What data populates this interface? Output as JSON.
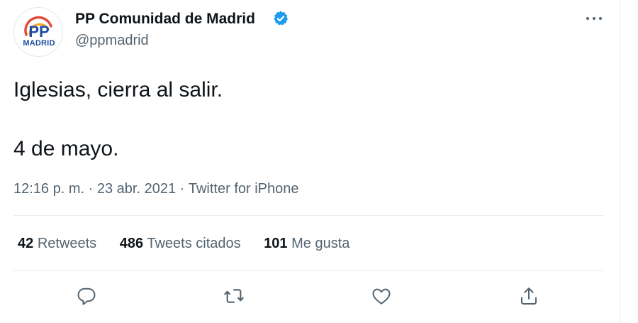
{
  "account": {
    "name": "PP Comunidad de Madrid",
    "handle": "@ppmadrid",
    "avatar_logo": "PP",
    "avatar_caption": "MADRID",
    "verified": true
  },
  "tweet": {
    "line1": "Iglesias, cierra al salir.",
    "line2": "4 de mayo.",
    "time": "12:16 p. m.",
    "separator": "·",
    "date": "23 abr. 2021",
    "source": "Twitter for iPhone"
  },
  "stats": [
    {
      "count": "42",
      "label": "Retweets"
    },
    {
      "count": "486",
      "label": "Tweets citados"
    },
    {
      "count": "101",
      "label": "Me gusta"
    }
  ],
  "actions": [
    "reply-icon",
    "retweet-icon",
    "like-icon",
    "share-icon"
  ],
  "colors": {
    "text": "#0f1419",
    "secondary": "#536471",
    "verified": "#1d9bf0",
    "divider": "#e6ecf0",
    "pp_blue": "#1f4ea1"
  }
}
